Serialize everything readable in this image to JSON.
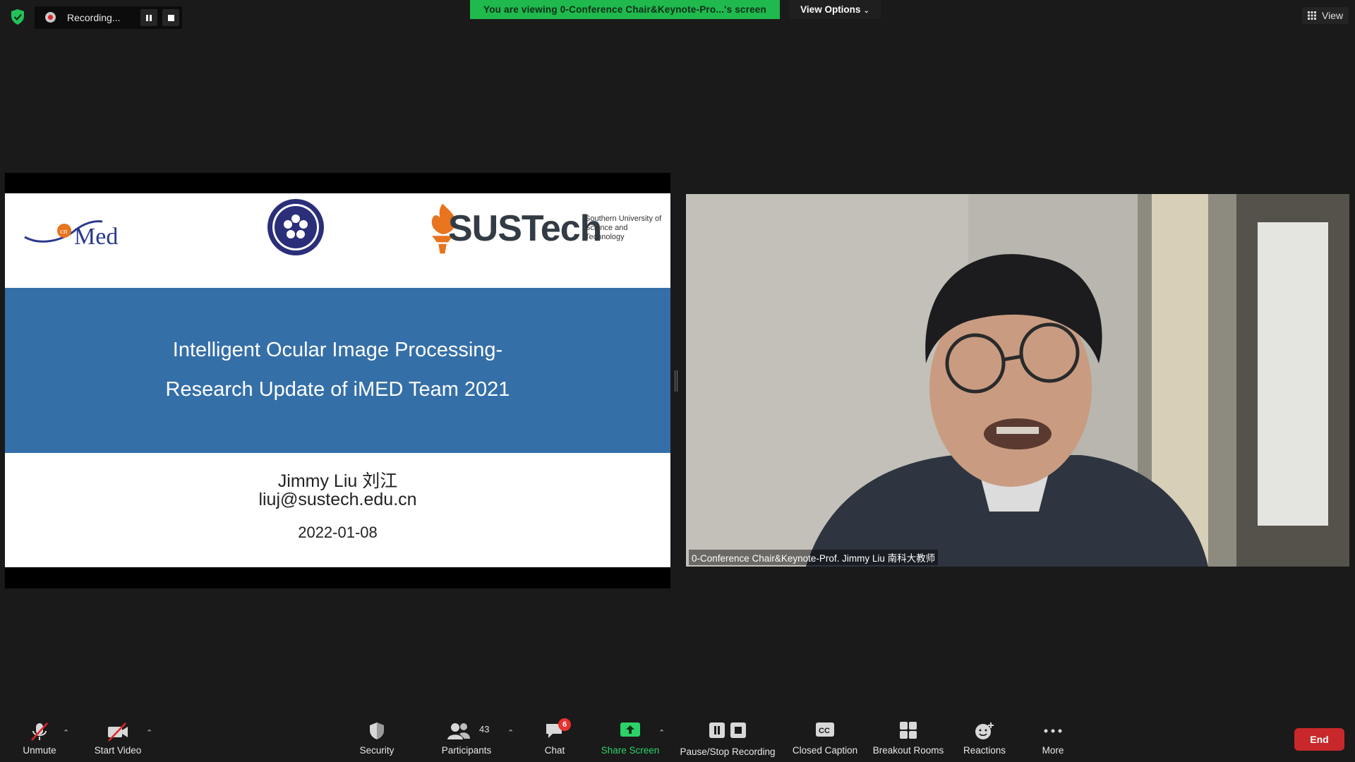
{
  "recording": {
    "label": "Recording..."
  },
  "banner": {
    "viewing_text": "You are viewing 0-Conference Chair&Keynote-Pro...'s screen",
    "view_options": "View Options"
  },
  "top_right": {
    "view_label": "View"
  },
  "slide": {
    "title_line1": "Intelligent Ocular Image Processing-",
    "title_line2": "Research Update of iMED Team 2021",
    "author": "Jimmy Liu 刘江",
    "email": "liuj@sustech.edu.cn",
    "date": "2022-01-08",
    "logo_imed_text": "Med",
    "logo_imed_badge": "cn",
    "logo_sustech": "SUSTech",
    "sustech_subtitle": "Southern University of Science and Technology",
    "colors": {
      "band": "#356fa8",
      "sustech_orange": "#e8741e",
      "cas_blue": "#2b2f7a"
    }
  },
  "video": {
    "participant_name": "0-Conference Chair&Keynote-Prof. Jimmy Liu 南科大教师"
  },
  "toolbar": {
    "unmute": "Unmute",
    "start_video": "Start Video",
    "security": "Security",
    "participants": "Participants",
    "participants_count": "43",
    "chat": "Chat",
    "chat_badge": "6",
    "share_screen": "Share Screen",
    "pause_stop_recording": "Pause/Stop Recording",
    "closed_caption": "Closed Caption",
    "breakout_rooms": "Breakout Rooms",
    "reactions": "Reactions",
    "more": "More",
    "end": "End",
    "colors": {
      "share": "#2bd26a",
      "end": "#c8282b",
      "badge": "#e8322e",
      "banner": "#20b94d"
    }
  }
}
